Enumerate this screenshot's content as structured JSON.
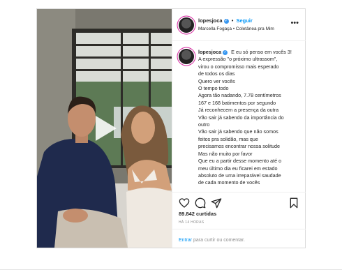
{
  "post": {
    "username": "lopesjoca",
    "follow_label": "Seguir",
    "separator": "•",
    "subtitle": "Marcella Fogaça • Coletânea pra Mim",
    "more_label": "•••",
    "caption_lines": [
      "E eu só penso em vocês 3!",
      "A expressão \"o próximo ultrassom\",",
      "virou o compromisso mais esperado",
      "de todos os dias",
      "Quero ver vocês",
      "O tempo todo",
      "Agora tão nadando, 7.78 centímetros",
      "167 e 168 batimentos por segundo",
      "Já reconhecem a presença da outra",
      "Vão sair já sabendo da importância do",
      "outro",
      "Vão sair já sabendo que não somos",
      "feitos pra solidão, mas que",
      "precisamos encontrar nossa solitude",
      "Mas não muito por favor",
      "Que eu a partir desse momento até o",
      "meu último dia eu ficarei em estado",
      "absoluto de uma irreparável saudade",
      "de cada momento de vocês"
    ],
    "likes": "89.842 curtidas",
    "time_ago": "HÁ 14 HORAS",
    "comment_link": "Entrar",
    "comment_text": " para curtir ou comentar."
  },
  "icons": {
    "like": "heart-icon",
    "comment": "comment-icon",
    "share": "paper-plane-icon",
    "save": "bookmark-icon",
    "play": "play-icon"
  }
}
